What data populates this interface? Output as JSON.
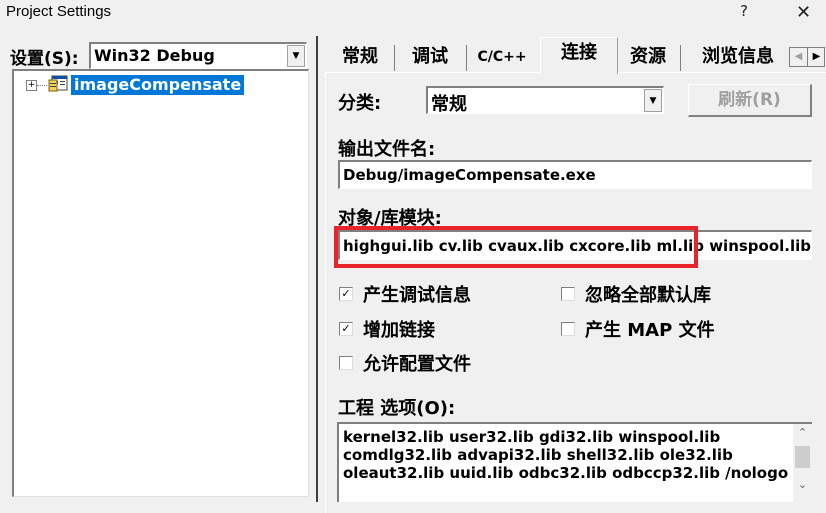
{
  "window": {
    "title": "Project Settings",
    "help_label": "?",
    "close_label": "✕"
  },
  "left": {
    "settings_label": "设置",
    "settings_accel": "(S):",
    "config_value": "Win32 Debug",
    "tree": {
      "expand_glyph": "+",
      "project_name": "imageCompensate"
    }
  },
  "tabs": [
    {
      "label": "常规",
      "active": false
    },
    {
      "label": "调试",
      "active": false
    },
    {
      "label": "C/C++",
      "active": false
    },
    {
      "label": "连接",
      "active": true
    },
    {
      "label": "资源",
      "active": false
    },
    {
      "label": "浏览信息",
      "active": false
    }
  ],
  "tab_scroll": {
    "left": "◀",
    "right": "▶"
  },
  "link": {
    "category_label": "分类:",
    "category_value": "常规",
    "reset_button": "刷新(R)",
    "output_label": "输出文件名:",
    "output_value": "Debug/imageCompensate.exe",
    "modules_label": "对象/库模块:",
    "modules_value": "highgui.lib cv.lib cvaux.lib cxcore.lib ml.lib winspool.lib co",
    "checkboxes": [
      {
        "label": "产生调试信息",
        "checked": true
      },
      {
        "label": "忽略全部默认库",
        "checked": false
      },
      {
        "label": "增加链接",
        "checked": true
      },
      {
        "label": "产生 MAP 文件",
        "checked": false
      },
      {
        "label": "允许配置文件",
        "checked": false
      }
    ],
    "options_label": "工程 选项(O):",
    "options_lines": [
      "kernel32.lib user32.lib gdi32.lib winspool.lib",
      "comdlg32.lib advapi32.lib shell32.lib ole32.lib",
      "oleaut32.lib uuid.lib odbc32.lib odbccp32.lib /nologo"
    ]
  },
  "glyphs": {
    "dropdown": "▼",
    "check": "✓",
    "scroll_up": "⌃",
    "scroll_down": "⌄"
  },
  "colors": {
    "selection": "#0078d7",
    "highlight_box": "#e8232a"
  }
}
